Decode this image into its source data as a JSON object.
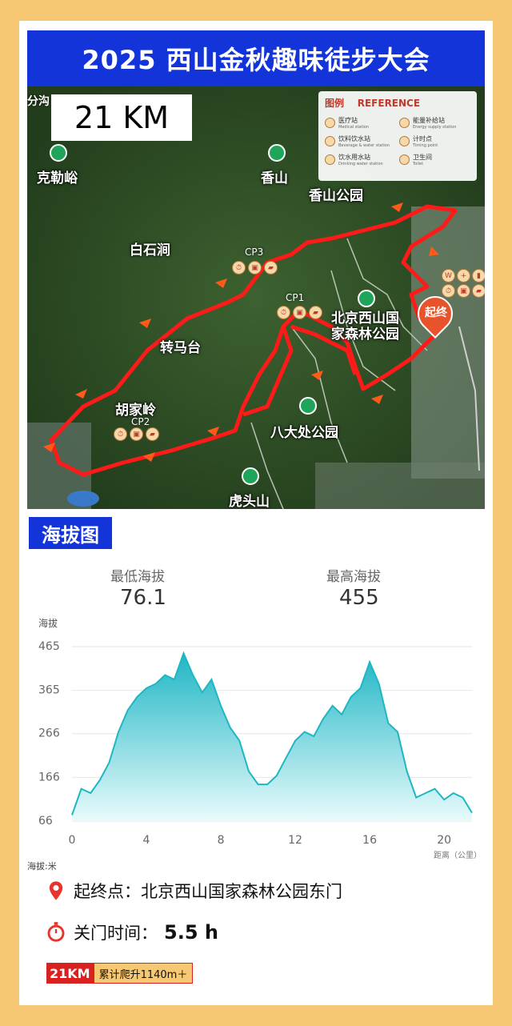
{
  "header": {
    "title": "2025 西山金秋趣味徒步大会"
  },
  "map": {
    "distance_badge": "21 KM",
    "corner_label": "分沟",
    "places": [
      {
        "id": "kelegu",
        "name": "克勒峪",
        "pin": true
      },
      {
        "id": "xiangshan",
        "name": "香山",
        "pin": true
      },
      {
        "id": "xiangshan-park",
        "name": "香山公园",
        "pin": false
      },
      {
        "id": "baishijian",
        "name": "白石涧",
        "pin": false
      },
      {
        "id": "zhuanmatai",
        "name": "转马台",
        "pin": false
      },
      {
        "id": "hujialing",
        "name": "胡家岭",
        "pin": false
      },
      {
        "id": "xishan-park",
        "name": "北京西山国\n家森林公园",
        "pin": true
      },
      {
        "id": "badachu",
        "name": "八大处公园",
        "pin": true
      },
      {
        "id": "hutoushan",
        "name": "虎头山",
        "pin": true
      }
    ],
    "checkpoints": [
      "CP1",
      "CP2",
      "CP3"
    ],
    "start_end_label": "起终",
    "legend": {
      "title": "图例",
      "title_en": "REFERENCE",
      "items": [
        {
          "label": "医疗站",
          "sub": "Medical station"
        },
        {
          "label": "能量补给站",
          "sub": "Energy supply station"
        },
        {
          "label": "饮料饮水站",
          "sub": "Beverage & water station"
        },
        {
          "label": "计时点",
          "sub": "Timing point"
        },
        {
          "label": "饮水用水站",
          "sub": "Drinking water station"
        },
        {
          "label": "卫生间",
          "sub": "Toilet"
        }
      ]
    },
    "colors": {
      "route": "#ff1a1a",
      "forest": "#2c4a24",
      "pin": "#1fa55a"
    }
  },
  "elevation": {
    "section_title": "海拔图",
    "min_label": "最低海拔",
    "min_value": "76.1",
    "max_label": "最高海拔",
    "max_value": "455",
    "axis_title": "海拔",
    "unit_note": "海拔:米",
    "x_axis_label": "距离（公里）"
  },
  "chart_data": {
    "type": "area",
    "x": [
      0,
      0.5,
      1,
      1.5,
      2,
      2.5,
      3,
      3.5,
      4,
      4.5,
      5,
      5.5,
      6,
      6.5,
      7,
      7.5,
      8,
      8.5,
      9,
      9.5,
      10,
      10.5,
      11,
      11.5,
      12,
      12.5,
      13,
      13.5,
      14,
      14.5,
      15,
      15.5,
      16,
      16.5,
      17,
      17.5,
      18,
      18.5,
      19,
      19.5,
      20,
      20.5,
      21,
      21.5
    ],
    "y": [
      80,
      140,
      130,
      160,
      200,
      270,
      320,
      350,
      370,
      380,
      400,
      390,
      450,
      400,
      360,
      390,
      330,
      280,
      250,
      180,
      150,
      150,
      170,
      210,
      250,
      270,
      260,
      300,
      330,
      310,
      350,
      370,
      430,
      380,
      290,
      270,
      180,
      120,
      130,
      140,
      115,
      130,
      120,
      85
    ],
    "xticks": [
      0,
      4,
      8,
      12,
      16,
      20
    ],
    "yticks": [
      66,
      166,
      266,
      365,
      465
    ],
    "xlim": [
      0,
      21.5
    ],
    "ylim": [
      66,
      465
    ],
    "ylabel": "海拔",
    "xlabel": "距离（公里）",
    "colors": {
      "line": "#1fb6c4",
      "fill_top": "#1fb6c4",
      "fill_bottom": "#e8fbfc"
    }
  },
  "info": {
    "start_end": "起终点：北京西山国家森林公园东门",
    "cutoff": "关门时间：",
    "cutoff_value": "5.5 h",
    "tag_distance": "21KM",
    "tag_climb": "累计爬升1140m＋"
  }
}
